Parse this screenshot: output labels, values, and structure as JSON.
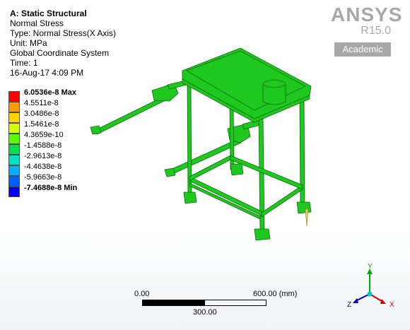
{
  "header": {
    "title": "A: Static Structural",
    "lines": [
      "Normal Stress",
      "Type: Normal Stress(X Axis)",
      "Unit: MPa",
      "Global Coordinate System",
      "Time: 1",
      "16-Aug-17 4:09 PM"
    ]
  },
  "legend": [
    {
      "label": "6.0536e-8 Max",
      "color": "#ff0000",
      "bold": true
    },
    {
      "label": "4.5511e-8",
      "color": "#ff9a00",
      "bold": false
    },
    {
      "label": "3.0486e-8",
      "color": "#ffd200",
      "bold": false
    },
    {
      "label": "1.5461e-8",
      "color": "#d4ff00",
      "bold": false
    },
    {
      "label": "4.3659e-10",
      "color": "#5aff00",
      "bold": false
    },
    {
      "label": "-1.4588e-8",
      "color": "#00e04a",
      "bold": false
    },
    {
      "label": "-2.9613e-8",
      "color": "#00e0c0",
      "bold": false
    },
    {
      "label": "-4.4638e-8",
      "color": "#00b0ff",
      "bold": false
    },
    {
      "label": "-5.9663e-8",
      "color": "#0060ff",
      "bold": false
    },
    {
      "label": "-7.4688e-8 Min",
      "color": "#0000ff",
      "bold": true
    }
  ],
  "logo": {
    "brand": "ANSYS",
    "version": "R15.0",
    "edition": "Academic"
  },
  "scale_bar": {
    "start": "0.00",
    "end": "600.00 (mm)",
    "mid": "300.00"
  },
  "triad": {
    "x_label": "X",
    "y_label": "Y",
    "z_label": "Z",
    "x_color": "#cc0000",
    "y_color": "#00aa00",
    "z_color": "#0000cc",
    "origin_color": "#00c8c8"
  },
  "model": {
    "fill_color": "#1ec81e",
    "edge_color": "#0b6e0b"
  }
}
